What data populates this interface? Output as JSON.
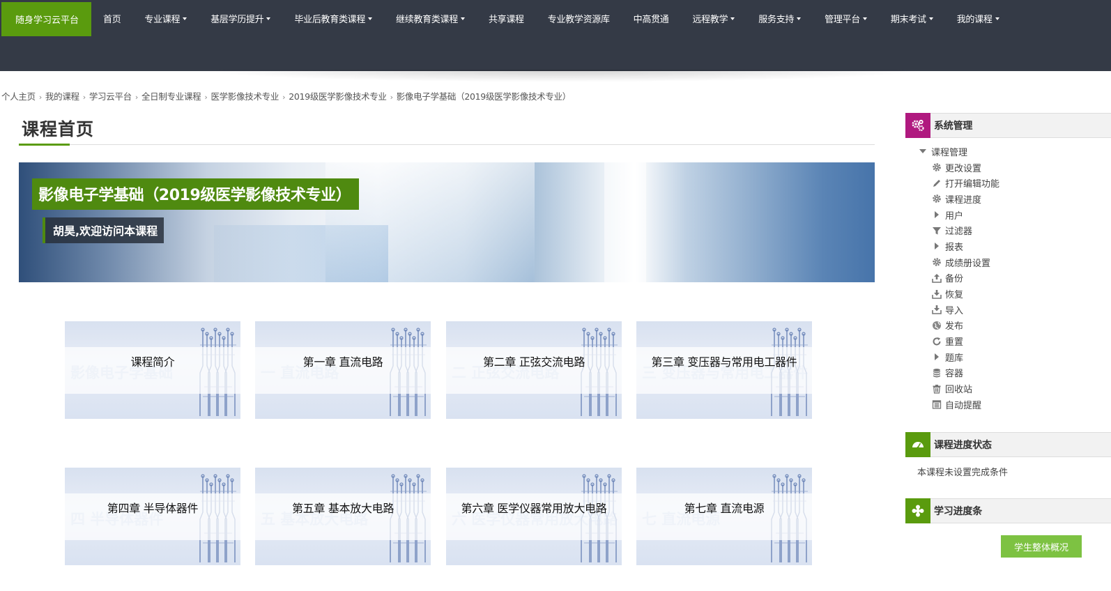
{
  "nav": {
    "brand": "随身学习云平台",
    "items": [
      {
        "label": "首页",
        "dropdown": false
      },
      {
        "label": "专业课程",
        "dropdown": true
      },
      {
        "label": "基层学历提升",
        "dropdown": true
      },
      {
        "label": "毕业后教育类课程",
        "dropdown": true
      },
      {
        "label": "继续教育类课程",
        "dropdown": true
      },
      {
        "label": "共享课程",
        "dropdown": false
      },
      {
        "label": "专业教学资源库",
        "dropdown": false
      },
      {
        "label": "中高贯通",
        "dropdown": false
      },
      {
        "label": "远程教学",
        "dropdown": true
      },
      {
        "label": "服务支持",
        "dropdown": true
      },
      {
        "label": "管理平台",
        "dropdown": true
      },
      {
        "label": "期末考试",
        "dropdown": true
      },
      {
        "label": "我的课程",
        "dropdown": true
      }
    ]
  },
  "breadcrumb": [
    "个人主页",
    "我的课程",
    "学习云平台",
    "全日制专业课程",
    "医学影像技术专业",
    "2019级医学影像技术专业",
    "影像电子学基础（2019级医学影像技术专业）"
  ],
  "page_title": "课程首页",
  "banner": {
    "title": "影像电子学基础（2019级医学影像技术专业）",
    "welcome": "胡昊,欢迎访问本课程"
  },
  "tiles": [
    {
      "label": "课程简介",
      "ghost": "影像电子学基础"
    },
    {
      "label": "第一章 直流电路",
      "ghost": "一 直流电路"
    },
    {
      "label": "第二章 正弦交流电路",
      "ghost": "二 正弦交流电路"
    },
    {
      "label": "第三章 变压器与常用电工器件",
      "ghost": "三 变压器与常用电工器件"
    },
    {
      "label": "第四章 半导体器件",
      "ghost": "四 半导体器件"
    },
    {
      "label": "第五章 基本放大电路",
      "ghost": "五 基本放大电路"
    },
    {
      "label": "第六章 医学仪器常用放大电路",
      "ghost": "六 医学仪器常用放大电路"
    },
    {
      "label": "第七章 直流电源",
      "ghost": "七 直流电源"
    }
  ],
  "sidebar": {
    "admin": {
      "title": "系统管理",
      "root": "课程管理",
      "items": [
        {
          "label": "更改设置",
          "icon": "gear-icon"
        },
        {
          "label": "打开编辑功能",
          "icon": "pencil-icon"
        },
        {
          "label": "课程进度",
          "icon": "gear-icon"
        },
        {
          "label": "用户",
          "icon": "expand-arrow-icon"
        },
        {
          "label": "过滤器",
          "icon": "filter-icon"
        },
        {
          "label": "报表",
          "icon": "expand-arrow-icon"
        },
        {
          "label": "成绩册设置",
          "icon": "gear-icon"
        },
        {
          "label": "备份",
          "icon": "upload-icon"
        },
        {
          "label": "恢复",
          "icon": "download-icon"
        },
        {
          "label": "导入",
          "icon": "download-icon"
        },
        {
          "label": "发布",
          "icon": "globe-icon"
        },
        {
          "label": "重置",
          "icon": "refresh-icon"
        },
        {
          "label": "题库",
          "icon": "expand-arrow-icon"
        },
        {
          "label": "容器",
          "icon": "database-icon"
        },
        {
          "label": "回收站",
          "icon": "trash-icon"
        },
        {
          "label": "自动提醒",
          "icon": "calendar-icon"
        }
      ]
    },
    "progress_status": {
      "title": "课程进度状态",
      "text": "本课程未设置完成条件"
    },
    "progress_bar": {
      "title": "学习进度条",
      "button": "学生整体概况"
    }
  },
  "colors": {
    "nav_bg": "#343a46",
    "brand_green": "#5a9b0e",
    "admin_icon": "#b0197f",
    "button_green": "#7dc242"
  }
}
